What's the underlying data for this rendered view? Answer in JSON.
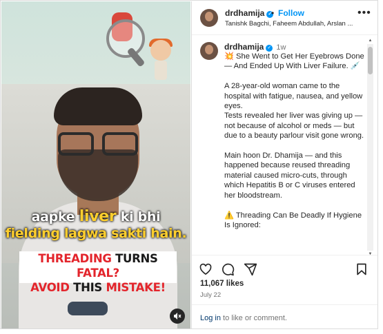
{
  "media": {
    "caption_line1_pre": "aapke ",
    "caption_line1_highlight": "liver",
    "caption_line1_post": " ki bhi",
    "caption_line2": "fielding lagwa sakti hain.",
    "banner_line1_a": "THREADING ",
    "banner_line1_b": "TURNS ",
    "banner_line1_c": "FATAL?",
    "banner_line2_a": "AVOID ",
    "banner_line2_b": "THIS ",
    "banner_line2_c": "MISTAKE!",
    "mute_icon": "muted-speaker-icon"
  },
  "header": {
    "username": "drdhamija",
    "verified_glyph": "✓",
    "separator": "•",
    "follow_label": "Follow",
    "collaborators": "Tanishk Bagchi, Faheem Abdullah, Arslan ...",
    "more_glyph": "•••"
  },
  "post": {
    "username": "drdhamija",
    "time": "1w",
    "caption": "💥 She Went to Get Her Eyebrows Done — And Ended Up With Liver Failure. 💉\n\nA 28-year-old woman came to the hospital with fatigue, nausea, and yellow eyes.\nTests revealed her liver was giving up — not because of alcohol or meds — but due to a beauty parlour visit gone wrong.\n\nMain hoon Dr. Dhamija — and this happened because reused threading material caused micro-cuts, through which Hepatitis B or C viruses entered her bloodstream.\n\n⚠️ Threading Can Be Deadly If Hygiene Is Ignored:"
  },
  "stats": {
    "likes": "11,067 likes",
    "date": "July 22"
  },
  "footer": {
    "login_link": "Log in",
    "login_text": " to like or comment."
  },
  "icons": [
    "heart-icon",
    "comment-icon",
    "share-icon",
    "bookmark-icon"
  ],
  "colors": {
    "accent": "#0095f6",
    "caption_yellow": "#ffcf2e",
    "banner_red": "#e3252c"
  }
}
